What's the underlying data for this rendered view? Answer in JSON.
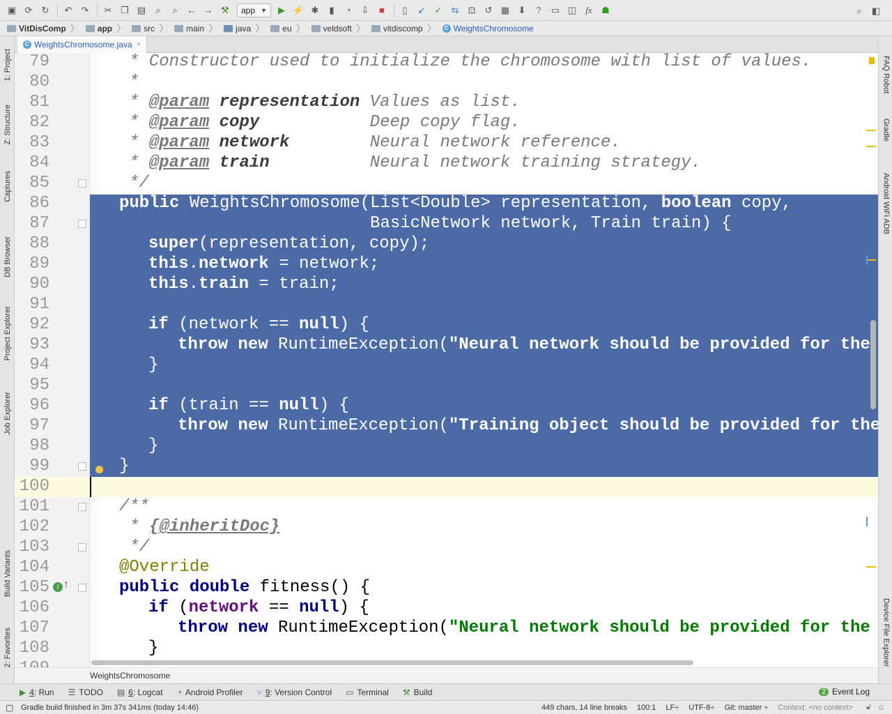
{
  "toolbar": {
    "run_config": "app",
    "icons": [
      "save-icon",
      "sync-icon",
      "refresh-icon",
      "undo-icon",
      "redo-icon",
      "cut-icon",
      "copy-icon",
      "paste-icon",
      "find-icon",
      "replace-icon",
      "back-icon",
      "forward-icon",
      "build-icon",
      "run-icon",
      "apply-changes-icon",
      "debug-icon",
      "coverage-icon",
      "profile-icon",
      "attach-icon",
      "stop-icon",
      "avd-icon",
      "vcs-update-icon",
      "vcs-commit-icon",
      "vcs-compare-icon",
      "vcs-history-icon",
      "vcs-revert-icon",
      "project-structure-icon",
      "sdk-icon",
      "help-icon",
      "terminal-icon",
      "sdk-manager-icon",
      "fx-icon",
      "android-icon",
      "search-everywhere-icon",
      "event-icon"
    ],
    "fx_label": "fx"
  },
  "breadcrumb": [
    "VitDisComp",
    "app",
    "src",
    "main",
    "java",
    "eu",
    "veldsoft",
    "vitdiscomp",
    "WeightsChromosome"
  ],
  "left_tools": [
    {
      "label": "1: Project"
    },
    {
      "label": "Z: Structure"
    },
    {
      "label": "Captures"
    },
    {
      "label": "DB Browser"
    },
    {
      "label": "Project Explorer"
    },
    {
      "label": "Job Explorer"
    },
    {
      "label": "Build Variants"
    },
    {
      "label": "2: Favorites"
    }
  ],
  "right_tools": [
    {
      "label": "FAQ Robot"
    },
    {
      "label": "Gradle"
    },
    {
      "label": "Android WiFi ADB"
    },
    {
      "label": "Device File Explorer"
    }
  ],
  "tab": {
    "name": "WeightsChromosome.java",
    "close": "×"
  },
  "code": {
    "l79": {
      "n": "79",
      "a": "* Constructor used to initialize the chromosome with list of values."
    },
    "l80": {
      "n": "80",
      "a": "*"
    },
    "l81": {
      "n": "81",
      "a": "* ",
      "b": "@param",
      "c": " ",
      "d": "representation",
      "e": " Values as list."
    },
    "l82": {
      "n": "82",
      "a": "* ",
      "b": "@param",
      "c": " ",
      "d": "copy",
      "e": "           Deep copy flag."
    },
    "l83": {
      "n": "83",
      "a": "* ",
      "b": "@param",
      "c": " ",
      "d": "network",
      "e": "        Neural network reference."
    },
    "l84": {
      "n": "84",
      "a": "* ",
      "b": "@param",
      "c": " ",
      "d": "train",
      "e": "          Neural network training strategy."
    },
    "l85": {
      "n": "85",
      "a": "*/"
    },
    "l86": {
      "n": "86",
      "a": "public",
      "b": " WeightsChromosome(List<Double> representation, ",
      "c": "boolean",
      "d": " copy,"
    },
    "l87": {
      "n": "87",
      "a": "                         BasicNetwork network, Train train) {"
    },
    "l88": {
      "n": "88",
      "a": "super",
      "b": "(representation, copy);"
    },
    "l89": {
      "n": "89",
      "a": "this",
      "b": ".",
      "c": "network",
      "d": " = network;"
    },
    "l90": {
      "n": "90",
      "a": "this",
      "b": ".",
      "c": "train",
      "d": " = train;"
    },
    "l91": {
      "n": "91"
    },
    "l92": {
      "n": "92",
      "a": "if",
      "b": " (network == ",
      "c": "null",
      "d": ") {"
    },
    "l93": {
      "n": "93",
      "a": "throw new",
      "b": " RuntimeException(",
      "c": "\"Neural network should be provided for the fi"
    },
    "l94": {
      "n": "94",
      "a": "}"
    },
    "l95": {
      "n": "95"
    },
    "l96": {
      "n": "96",
      "a": "if",
      "b": " (train == ",
      "c": "null",
      "d": ") {"
    },
    "l97": {
      "n": "97",
      "a": "throw new",
      "b": " RuntimeException(",
      "c": "\"Training object should be provided for the f"
    },
    "l98": {
      "n": "98",
      "a": "}"
    },
    "l99": {
      "n": "99",
      "a": "}"
    },
    "l100": {
      "n": "100"
    },
    "l101": {
      "n": "101",
      "a": "/**"
    },
    "l102": {
      "n": "102",
      "a": " * ",
      "b": "{@inheritDoc}"
    },
    "l103": {
      "n": "103",
      "a": " */"
    },
    "l104": {
      "n": "104",
      "a": "@Override"
    },
    "l105": {
      "n": "105",
      "a": "public double",
      "b": " fitness() {"
    },
    "l106": {
      "n": "106",
      "a": "if",
      "b": " (",
      "c": "network",
      "d": " == ",
      "e": "null",
      "f": ") {"
    },
    "l107": {
      "n": "107",
      "a": "throw new",
      "b": " RuntimeException(",
      "c": "\"Neural network should be provided for the fi"
    },
    "l108": {
      "n": "108",
      "a": "}"
    },
    "l109": {
      "n": "109"
    }
  },
  "bottom_breadcrumb": "WeightsChromosome",
  "bottom_tools": [
    {
      "key": "4",
      "label": ": Run"
    },
    {
      "key": "",
      "label": "TODO"
    },
    {
      "key": "6",
      "label": ": Logcat"
    },
    {
      "key": "",
      "label": "Android Profiler"
    },
    {
      "key": "9",
      "label": ": Version Control"
    },
    {
      "key": "",
      "label": "Terminal"
    },
    {
      "key": "",
      "label": "Build"
    }
  ],
  "event_log": {
    "count": "2",
    "label": "Event Log"
  },
  "status": {
    "message": "Gradle build finished in 3m 37s 341ms (today 14:46)",
    "chars": "449 chars, 14 line breaks",
    "position": "100:1",
    "line_sep": "LF÷",
    "encoding": "UTF-8÷",
    "git": "Git: master ÷",
    "context": "Context: <no context>"
  },
  "colors": {
    "selection": "#4b6aa6",
    "current_line": "#fdfbe0",
    "keyword": "#000080",
    "string": "#007a00",
    "field": "#660e7a"
  }
}
